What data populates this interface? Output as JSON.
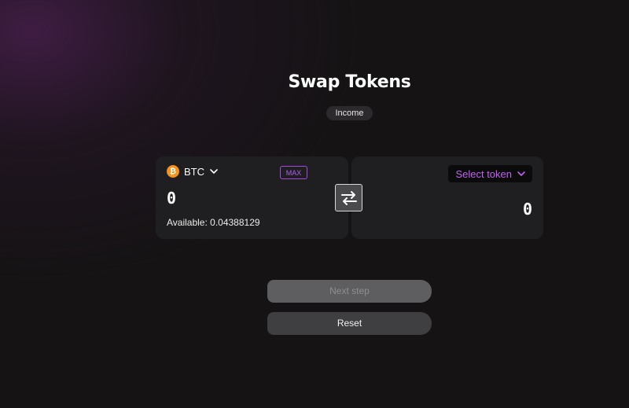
{
  "header": {
    "title": "Swap Tokens",
    "tag": "Income"
  },
  "from": {
    "token": "BTC",
    "token_icon": "bitcoin-icon",
    "token_icon_glyph": "₿",
    "max_label": "MAX",
    "amount": "0",
    "available": "Available: 0.04388129"
  },
  "to": {
    "select_label": "Select token",
    "amount": "0"
  },
  "swap": {
    "icon": "swap-arrows-icon"
  },
  "actions": {
    "next_label": "Next step",
    "reset_label": "Reset"
  },
  "colors": {
    "accent": "#b35ef0",
    "bitcoin": "#f7931a",
    "card": "#1f1e20"
  }
}
